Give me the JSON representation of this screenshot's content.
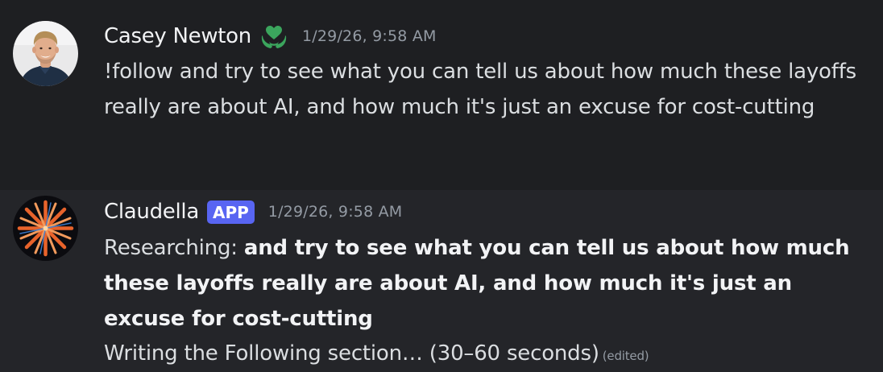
{
  "messages": [
    {
      "username": "Casey Newton",
      "role_icon": "heart-hands-icon",
      "timestamp": "1/29/26, 9:58 AM",
      "text": "!follow and try to see what you can tell us about how much these layoffs really are about AI, and how much it's just an excuse for cost-cutting"
    },
    {
      "username": "Claudella",
      "tag": "APP",
      "timestamp": "1/29/26, 9:58 AM",
      "prefix": "Researching: ",
      "bold_text": "and try to see what you can tell us about how much these layoffs really are about AI, and how much it's just an excuse for cost-cutting",
      "status": "Writing the Following section… (30–60 seconds)",
      "edited": "(edited)"
    }
  ],
  "colors": {
    "background": "#1e1f22",
    "hover_background": "#242529",
    "username": "#f2f3f5",
    "text": "#dbdee1",
    "timestamp": "#949ba4",
    "app_tag": "#5865f2",
    "role_icon": "#3ba55d"
  }
}
